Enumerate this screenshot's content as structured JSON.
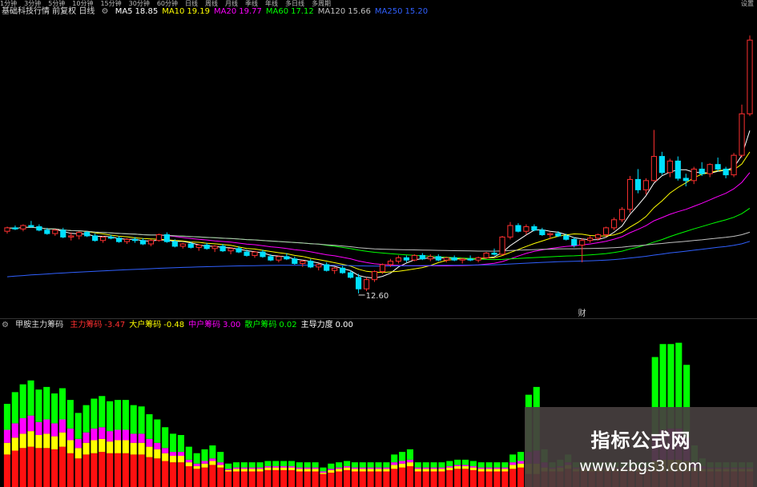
{
  "topbar": {
    "timeframes": [
      "1分钟",
      "3分钟",
      "5分钟",
      "10分钟",
      "15分钟",
      "30分钟",
      "60分钟",
      "日线",
      "周线",
      "月线",
      "季线",
      "年线",
      "多日线",
      "多周期"
    ],
    "right_text": "设置"
  },
  "main_legend": {
    "title": "基础科技行情 前复权 日线",
    "items": [
      {
        "label": "MA5",
        "value": "18.85",
        "color": "#ffffff"
      },
      {
        "label": "MA10",
        "value": "19.19",
        "color": "#ffff00"
      },
      {
        "label": "MA20",
        "value": "19.77",
        "color": "#ff00ff"
      },
      {
        "label": "MA60",
        "value": "17.12",
        "color": "#00ff00"
      },
      {
        "label": "MA120",
        "value": "15.66",
        "color": "#c0c0c0"
      },
      {
        "label": "MA250",
        "value": "15.20",
        "color": "#3060ff"
      }
    ]
  },
  "low_price_label": "12.60",
  "event_marker": "财",
  "indicator_legend": {
    "title": "甲胺主力筹码",
    "items": [
      {
        "label": "主力筹码",
        "value": "-3.47",
        "color": "#ff3030"
      },
      {
        "label": "大户筹码",
        "value": "-0.48",
        "color": "#ffff00"
      },
      {
        "label": "中户筹码",
        "value": "3.00",
        "color": "#ff00ff"
      },
      {
        "label": "散户筹码",
        "value": "0.02",
        "color": "#00ff00"
      },
      {
        "label": "主导力度",
        "value": "0.00",
        "color": "#ffffff"
      }
    ]
  },
  "watermark": {
    "title": "指标公式网",
    "url": "www.zbgs3.com"
  },
  "colors": {
    "up": "#ff3030",
    "down": "#00e0ff",
    "stack": [
      "#ff1010",
      "#ffff00",
      "#ff00ff",
      "#00ff00"
    ]
  },
  "candles": [
    [
      18.0,
      18.4,
      17.8,
      18.3
    ],
    [
      18.3,
      18.5,
      18.1,
      18.2
    ],
    [
      18.2,
      18.6,
      18.0,
      18.5
    ],
    [
      18.5,
      18.9,
      18.3,
      18.4
    ],
    [
      18.4,
      18.6,
      18.0,
      18.1
    ],
    [
      18.1,
      18.3,
      17.7,
      17.8
    ],
    [
      17.8,
      18.2,
      17.6,
      18.1
    ],
    [
      18.1,
      18.3,
      17.4,
      17.5
    ],
    [
      17.5,
      17.9,
      17.2,
      17.6
    ],
    [
      17.6,
      18.0,
      17.3,
      17.9
    ],
    [
      17.9,
      18.0,
      17.5,
      17.6
    ],
    [
      17.6,
      17.8,
      17.1,
      17.2
    ],
    [
      17.2,
      17.6,
      17.0,
      17.5
    ],
    [
      17.5,
      17.7,
      17.3,
      17.4
    ],
    [
      17.4,
      17.6,
      17.0,
      17.1
    ],
    [
      17.1,
      17.4,
      16.9,
      17.3
    ],
    [
      17.3,
      17.5,
      17.0,
      17.2
    ],
    [
      17.2,
      17.4,
      16.8,
      16.9
    ],
    [
      16.9,
      17.3,
      16.7,
      17.2
    ],
    [
      17.2,
      17.8,
      17.1,
      17.7
    ],
    [
      17.7,
      17.9,
      17.0,
      17.1
    ],
    [
      17.1,
      17.3,
      16.6,
      16.7
    ],
    [
      16.7,
      17.0,
      16.5,
      16.9
    ],
    [
      16.9,
      17.1,
      16.5,
      16.6
    ],
    [
      16.6,
      16.9,
      16.3,
      16.8
    ],
    [
      16.8,
      17.0,
      16.4,
      16.5
    ],
    [
      16.5,
      16.8,
      16.2,
      16.7
    ],
    [
      16.7,
      16.9,
      16.2,
      16.3
    ],
    [
      16.3,
      16.6,
      16.0,
      16.5
    ],
    [
      16.5,
      16.7,
      16.1,
      16.2
    ],
    [
      16.2,
      16.4,
      15.8,
      15.9
    ],
    [
      15.9,
      16.3,
      15.7,
      16.2
    ],
    [
      16.2,
      16.4,
      15.7,
      15.8
    ],
    [
      15.8,
      16.0,
      15.4,
      15.5
    ],
    [
      15.5,
      15.9,
      15.3,
      15.8
    ],
    [
      15.8,
      16.1,
      15.5,
      15.6
    ],
    [
      15.6,
      15.8,
      15.1,
      15.2
    ],
    [
      15.2,
      15.5,
      14.9,
      15.4
    ],
    [
      15.4,
      15.6,
      14.8,
      14.9
    ],
    [
      14.9,
      15.2,
      14.6,
      15.1
    ],
    [
      15.1,
      15.3,
      14.5,
      14.6
    ],
    [
      14.6,
      14.9,
      14.3,
      14.8
    ],
    [
      14.8,
      15.0,
      14.3,
      14.4
    ],
    [
      14.4,
      14.6,
      13.9,
      14.0
    ],
    [
      14.0,
      14.3,
      12.6,
      13.0
    ],
    [
      13.0,
      14.0,
      12.8,
      13.8
    ],
    [
      13.8,
      14.6,
      13.6,
      14.5
    ],
    [
      14.5,
      15.2,
      14.3,
      15.1
    ],
    [
      15.1,
      15.6,
      14.9,
      15.4
    ],
    [
      15.4,
      15.9,
      15.2,
      15.7
    ],
    [
      15.7,
      15.9,
      15.3,
      15.5
    ],
    [
      15.5,
      16.0,
      15.4,
      15.9
    ],
    [
      15.9,
      16.1,
      15.5,
      15.6
    ],
    [
      15.6,
      16.0,
      15.4,
      15.8
    ],
    [
      15.8,
      16.0,
      15.4,
      15.5
    ],
    [
      15.5,
      15.8,
      15.3,
      15.7
    ],
    [
      15.7,
      15.9,
      15.4,
      15.5
    ],
    [
      15.5,
      15.7,
      15.2,
      15.6
    ],
    [
      15.6,
      15.9,
      15.4,
      15.5
    ],
    [
      15.5,
      15.8,
      15.3,
      15.7
    ],
    [
      15.7,
      16.2,
      15.6,
      16.1
    ],
    [
      16.1,
      16.5,
      15.9,
      16.0
    ],
    [
      16.0,
      17.6,
      15.9,
      17.5
    ],
    [
      17.5,
      18.8,
      17.3,
      18.5
    ],
    [
      18.5,
      18.7,
      17.9,
      18.0
    ],
    [
      18.0,
      18.6,
      17.7,
      18.4
    ],
    [
      18.4,
      18.6,
      18.0,
      18.1
    ],
    [
      18.1,
      18.3,
      17.6,
      17.7
    ],
    [
      17.7,
      17.9,
      17.3,
      17.8
    ],
    [
      17.8,
      18.0,
      17.5,
      17.6
    ],
    [
      17.6,
      17.8,
      17.2,
      17.3
    ],
    [
      17.3,
      17.5,
      16.6,
      16.8
    ],
    [
      16.8,
      17.4,
      15.3,
      17.2
    ],
    [
      17.2,
      17.6,
      17.0,
      17.4
    ],
    [
      17.4,
      17.8,
      17.2,
      17.7
    ],
    [
      17.7,
      18.4,
      17.5,
      18.3
    ],
    [
      18.3,
      19.2,
      18.1,
      19.0
    ],
    [
      19.0,
      20.1,
      18.8,
      19.9
    ],
    [
      19.9,
      22.8,
      19.6,
      22.5
    ],
    [
      22.5,
      23.4,
      21.3,
      21.6
    ],
    [
      21.6,
      22.6,
      21.2,
      22.4
    ],
    [
      22.4,
      26.8,
      22.3,
      24.5
    ],
    [
      24.5,
      24.9,
      22.9,
      23.1
    ],
    [
      23.1,
      24.3,
      22.7,
      24.1
    ],
    [
      24.1,
      24.5,
      22.4,
      22.6
    ],
    [
      22.6,
      23.0,
      21.9,
      22.4
    ],
    [
      22.4,
      23.6,
      22.1,
      23.4
    ],
    [
      23.4,
      24.0,
      22.8,
      23.0
    ],
    [
      23.0,
      23.9,
      22.7,
      23.8
    ],
    [
      23.8,
      24.4,
      23.2,
      23.4
    ],
    [
      23.4,
      23.6,
      22.6,
      22.9
    ],
    [
      22.9,
      24.8,
      22.7,
      24.6
    ],
    [
      24.6,
      29.0,
      24.4,
      28.2
    ],
    [
      28.2,
      35.0,
      28.0,
      34.6
    ]
  ],
  "chart_data": {
    "type": "bar",
    "series": [
      {
        "name": "主力筹码",
        "values": [
          2.5,
          2.8,
          3.0,
          3.1,
          3.0,
          3.0,
          2.9,
          3.1,
          2.6,
          2.2,
          2.5,
          2.6,
          2.7,
          2.6,
          2.6,
          2.6,
          2.5,
          2.5,
          2.3,
          2.2,
          2.0,
          1.9,
          1.9,
          1.6,
          1.4,
          1.5,
          1.7,
          1.5,
          1.2,
          1.2,
          1.2,
          1.2,
          1.2,
          1.3,
          1.3,
          1.3,
          1.3,
          1.2,
          1.2,
          1.2,
          1.0,
          1.1,
          1.2,
          1.3,
          1.2,
          1.2,
          1.2,
          1.2,
          1.2,
          1.4,
          1.5,
          1.6,
          1.2,
          1.2,
          1.2,
          1.2,
          1.3,
          1.4,
          1.4,
          1.3,
          1.2,
          1.2,
          1.2,
          1.2,
          1.4,
          1.5,
          1.0,
          1.0,
          1.2,
          1.2,
          1.2,
          1.4,
          1.2,
          1.2,
          1.2,
          1.2,
          1.2,
          1.2,
          1.2,
          1.2,
          1.2,
          1.2,
          1.2,
          1.2,
          1.2,
          1.2,
          1.2,
          1.2,
          1.2,
          1.2,
          1.2,
          1.2,
          1.2,
          1.2,
          1.2
        ]
      },
      {
        "name": "大户筹码",
        "values": [
          0.9,
          1.0,
          1.1,
          1.2,
          1.0,
          1.1,
          1.0,
          1.1,
          1.0,
          0.8,
          0.9,
          1.0,
          1.0,
          0.9,
          1.0,
          1.0,
          0.9,
          0.9,
          0.8,
          0.7,
          0.6,
          0.5,
          0.5,
          0.3,
          0.2,
          0.3,
          0.3,
          0.2,
          0.1,
          0.2,
          0.2,
          0.2,
          0.2,
          0.2,
          0.2,
          0.2,
          0.2,
          0.2,
          0.2,
          0.2,
          0.1,
          0.2,
          0.2,
          0.2,
          0.2,
          0.2,
          0.2,
          0.2,
          0.2,
          0.3,
          0.3,
          0.3,
          0.2,
          0.2,
          0.2,
          0.2,
          0.2,
          0.2,
          0.2,
          0.2,
          0.2,
          0.2,
          0.2,
          0.2,
          0.3,
          0.3,
          0.8,
          0.8,
          0.3,
          0.2,
          0.3,
          0.3,
          0.2,
          0.2,
          0.2,
          0.2,
          0.2,
          0.2,
          0.2,
          0.2,
          0.2,
          0.2,
          0.8,
          0.9,
          0.9,
          0.9,
          0.8,
          0.3,
          0.2,
          0.2,
          0.2,
          0.2,
          0.2,
          0.2,
          0.2
        ]
      },
      {
        "name": "中户筹码",
        "values": [
          1.0,
          1.1,
          1.2,
          1.2,
          1.0,
          1.1,
          1.0,
          1.0,
          0.9,
          0.7,
          0.8,
          0.9,
          0.9,
          0.8,
          0.8,
          0.8,
          0.7,
          0.7,
          0.6,
          0.5,
          0.4,
          0.3,
          0.3,
          0.2,
          0.2,
          0.2,
          0.2,
          0.2,
          0.1,
          0.1,
          0.1,
          0.1,
          0.1,
          0.1,
          0.1,
          0.1,
          0.1,
          0.1,
          0.1,
          0.1,
          0.1,
          0.1,
          0.1,
          0.1,
          0.1,
          0.1,
          0.1,
          0.1,
          0.1,
          0.2,
          0.2,
          0.2,
          0.1,
          0.1,
          0.1,
          0.1,
          0.1,
          0.1,
          0.1,
          0.1,
          0.1,
          0.1,
          0.1,
          0.1,
          0.2,
          0.2,
          0.9,
          1.0,
          0.4,
          0.1,
          0.1,
          0.2,
          0.1,
          0.1,
          0.1,
          0.1,
          0.1,
          0.1,
          0.1,
          0.1,
          0.1,
          0.1,
          2.0,
          2.3,
          2.4,
          2.4,
          1.8,
          0.4,
          0.2,
          0.1,
          0.1,
          0.1,
          0.1,
          0.1,
          0.1
        ]
      },
      {
        "name": "散户筹码",
        "values": [
          2.0,
          2.4,
          2.6,
          2.7,
          2.5,
          2.5,
          2.3,
          2.4,
          2.2,
          2.0,
          2.1,
          2.3,
          2.4,
          2.3,
          2.3,
          2.3,
          2.2,
          2.1,
          1.9,
          1.8,
          1.6,
          1.4,
          1.3,
          1.0,
          0.8,
          0.9,
          1.0,
          0.8,
          0.4,
          0.4,
          0.4,
          0.4,
          0.4,
          0.4,
          0.4,
          0.4,
          0.4,
          0.4,
          0.4,
          0.4,
          0.3,
          0.4,
          0.4,
          0.4,
          0.4,
          0.4,
          0.4,
          0.4,
          0.4,
          0.6,
          0.7,
          0.8,
          0.4,
          0.4,
          0.4,
          0.4,
          0.4,
          0.4,
          0.4,
          0.4,
          0.4,
          0.4,
          0.4,
          0.4,
          0.6,
          0.7,
          4.4,
          4.9,
          1.0,
          0.4,
          0.5,
          0.6,
          0.4,
          0.4,
          0.4,
          0.4,
          0.4,
          0.4,
          0.4,
          0.4,
          0.4,
          0.4,
          6.0,
          6.6,
          6.5,
          6.6,
          5.6,
          1.3,
          0.6,
          0.4,
          0.4,
          0.4,
          0.4,
          0.4,
          0.4
        ]
      }
    ]
  }
}
